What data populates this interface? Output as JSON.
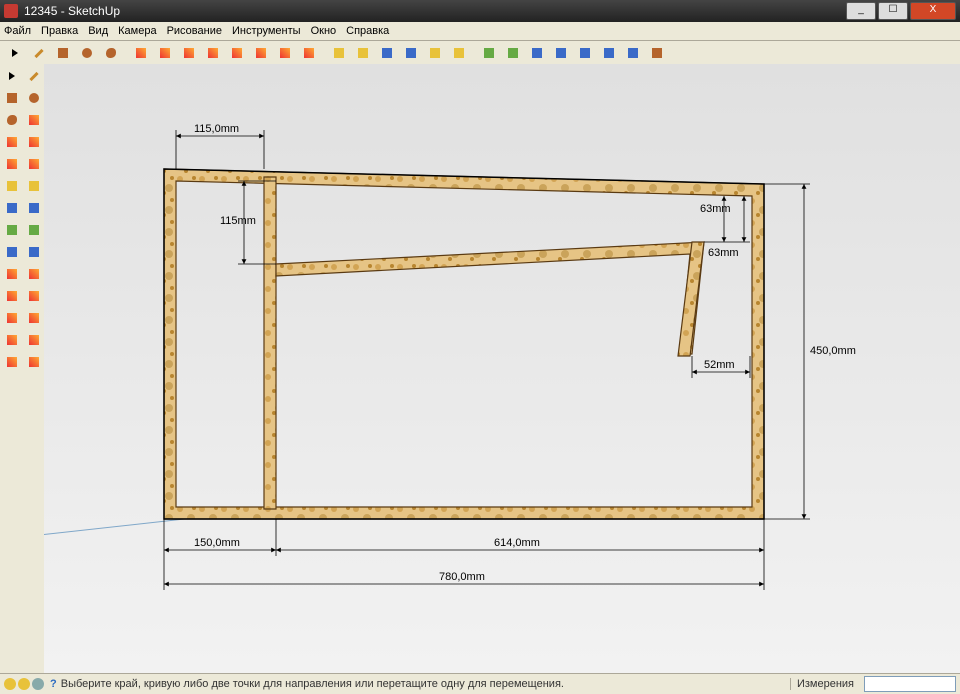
{
  "window": {
    "title": "12345 - SketchUp",
    "buttons": {
      "min": "_",
      "max": "☐",
      "close": "X"
    }
  },
  "menu": [
    "Файл",
    "Правка",
    "Вид",
    "Камера",
    "Рисование",
    "Инструменты",
    "Окно",
    "Справка"
  ],
  "top_tools": [
    {
      "name": "select-arrow",
      "cls": "i-arrow"
    },
    {
      "name": "pencil",
      "cls": "i-pencil"
    },
    {
      "name": "rectangle",
      "cls": "i-box"
    },
    {
      "name": "circle",
      "cls": "i-circle"
    },
    {
      "name": "freehand",
      "cls": "i-blob"
    },
    {
      "sep": true
    },
    {
      "name": "eraser",
      "cls": "i-tool"
    },
    {
      "name": "paint",
      "cls": "i-tool"
    },
    {
      "name": "move",
      "cls": "i-tool"
    },
    {
      "name": "rotate",
      "cls": "i-tool"
    },
    {
      "name": "scale",
      "cls": "i-tool"
    },
    {
      "name": "pushpull",
      "cls": "i-tool"
    },
    {
      "name": "follow",
      "cls": "i-tool"
    },
    {
      "name": "offset",
      "cls": "i-tool"
    },
    {
      "sep": true
    },
    {
      "name": "tape",
      "cls": "i-yellow"
    },
    {
      "name": "protractor",
      "cls": "i-yellow"
    },
    {
      "name": "axes",
      "cls": "i-blue"
    },
    {
      "name": "dimension",
      "cls": "i-blue"
    },
    {
      "name": "text",
      "cls": "i-yellow"
    },
    {
      "name": "section",
      "cls": "i-yellow"
    },
    {
      "sep": true
    },
    {
      "name": "orbit",
      "cls": "i-green"
    },
    {
      "name": "pan",
      "cls": "i-green"
    },
    {
      "name": "zoom",
      "cls": "i-blue"
    },
    {
      "name": "zoom-window",
      "cls": "i-blue"
    },
    {
      "name": "zoom-extents",
      "cls": "i-blue"
    },
    {
      "name": "previous",
      "cls": "i-blue"
    },
    {
      "name": "next",
      "cls": "i-blue"
    },
    {
      "name": "iso",
      "cls": "i-box"
    }
  ],
  "left_tools": [
    [
      "select",
      "eraser"
    ],
    [
      "line",
      "arc"
    ],
    [
      "rect",
      "circle"
    ],
    [
      "poly",
      "free"
    ],
    [
      "move",
      "push"
    ],
    [
      "rotate",
      "follow"
    ],
    [
      "scale",
      "offset"
    ],
    [
      "tape",
      "dim"
    ],
    [
      "prot",
      "text"
    ],
    [
      "paint",
      "axes"
    ],
    [
      "orbit",
      "pan"
    ],
    [
      "zoom",
      "zext"
    ],
    [
      "sect",
      "walk"
    ],
    [
      "pos",
      "look"
    ]
  ],
  "status": {
    "hint": "Выберите край, кривую либо две точки для направления или перетащите одну для перемещения.",
    "measure_label": "Измерения"
  },
  "dims": {
    "d115_0": "115,0mm",
    "d115": "115mm",
    "d63a": "63mm",
    "d63b": "63mm",
    "d52": "52mm",
    "d450": "450,0mm",
    "d150": "150,0mm",
    "d614": "614,0mm",
    "d780": "780,0mm"
  }
}
